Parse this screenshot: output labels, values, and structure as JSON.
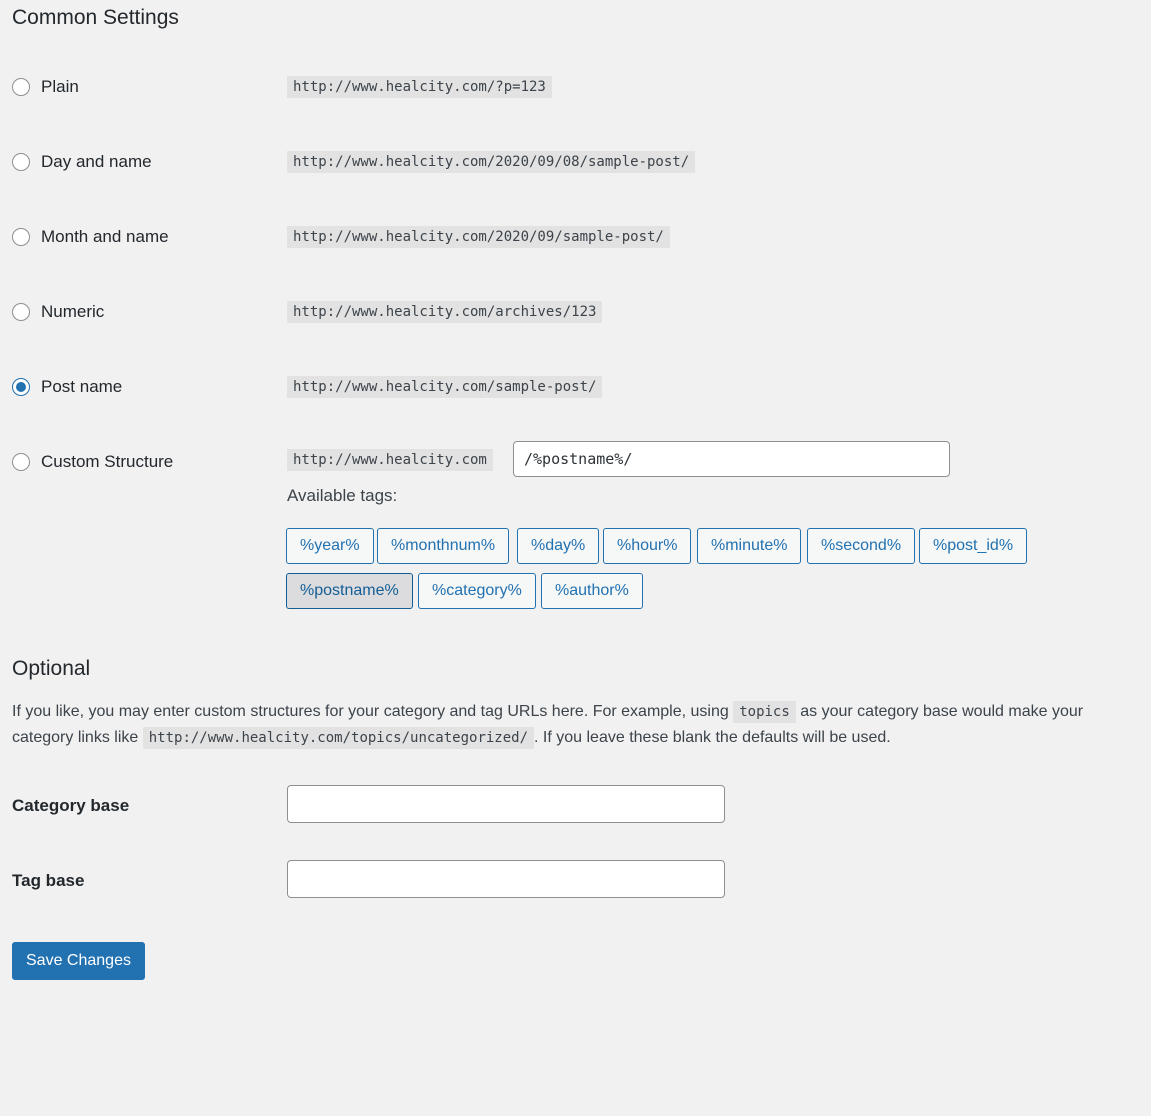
{
  "common": {
    "heading": "Common Settings",
    "options": [
      {
        "label": "Plain",
        "url": "http://www.healcity.com/?p=123",
        "checked": false
      },
      {
        "label": "Day and name",
        "url": "http://www.healcity.com/2020/09/08/sample-post/",
        "checked": false
      },
      {
        "label": "Month and name",
        "url": "http://www.healcity.com/2020/09/sample-post/",
        "checked": false
      },
      {
        "label": "Numeric",
        "url": "http://www.healcity.com/archives/123",
        "checked": false
      },
      {
        "label": "Post name",
        "url": "http://www.healcity.com/sample-post/",
        "checked": true
      },
      {
        "label": "Custom Structure",
        "url": "http://www.healcity.com",
        "checked": false
      }
    ],
    "custom_value": "/%postname%/",
    "available_tags_label": "Available tags:",
    "tags": [
      "%year%",
      "%monthnum%",
      "%day%",
      "%hour%",
      "%minute%",
      "%second%",
      "%post_id%",
      "%postname%",
      "%category%",
      "%author%"
    ],
    "active_tag": "%postname%"
  },
  "optional": {
    "heading": "Optional",
    "desc_part1": "If you like, you may enter custom structures for your category and tag URLs here. For example, using",
    "desc_code1": "topics",
    "desc_part2": "as your category base would make your category links like",
    "desc_code2": "http://www.healcity.com/topics/uncategorized/",
    "desc_part3": ". If you leave these blank the defaults will be used.",
    "category_base_label": "Category base",
    "category_base_value": "",
    "tag_base_label": "Tag base",
    "tag_base_value": ""
  },
  "save_label": "Save Changes",
  "colors": {
    "accent": "#2271b1",
    "background": "#f1f1f1",
    "code_bg": "#e2e2e2"
  }
}
